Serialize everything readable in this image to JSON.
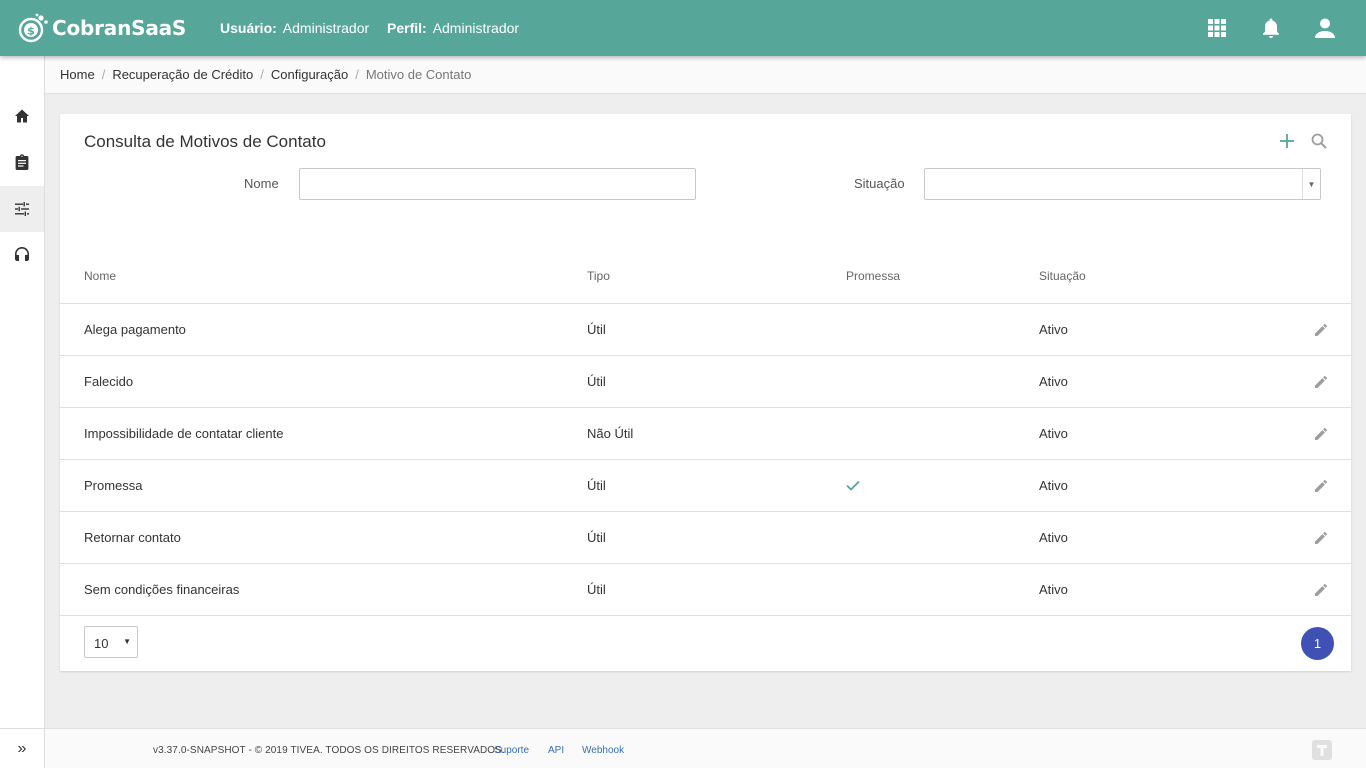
{
  "header": {
    "brand": "CobranSaaS",
    "user_label": "Usuário:",
    "user_value": "Administrador",
    "profile_label": "Perfil:",
    "profile_value": "Administrador",
    "icons": [
      "apps-grid-icon",
      "bell-icon",
      "account-icon"
    ],
    "color": "#56a69a"
  },
  "sidebar": {
    "items": [
      {
        "icon": "home-icon"
      },
      {
        "icon": "clipboard-icon"
      },
      {
        "icon": "sliders-icon",
        "active": true
      },
      {
        "icon": "headset-icon"
      }
    ],
    "expand": "»"
  },
  "breadcrumb": {
    "items": [
      "Home",
      "Recuperação de Crédito",
      "Configuração"
    ],
    "current": "Motivo de Contato",
    "separator": "/"
  },
  "card": {
    "title": "Consulta de Motivos de Contato",
    "filters": {
      "nome_label": "Nome",
      "nome_value": "",
      "situacao_label": "Situação",
      "situacao_value": ""
    }
  },
  "table": {
    "columns": [
      "Nome",
      "Tipo",
      "Promessa",
      "Situação"
    ],
    "rows": [
      {
        "nome": "Alega pagamento",
        "tipo": "Útil",
        "promessa": false,
        "situacao": "Ativo"
      },
      {
        "nome": "Falecido",
        "tipo": "Útil",
        "promessa": false,
        "situacao": "Ativo"
      },
      {
        "nome": "Impossibilidade de contatar cliente",
        "tipo": "Não Útil",
        "promessa": false,
        "situacao": "Ativo"
      },
      {
        "nome": "Promessa",
        "tipo": "Útil",
        "promessa": true,
        "situacao": "Ativo"
      },
      {
        "nome": "Retornar contato",
        "tipo": "Útil",
        "promessa": false,
        "situacao": "Ativo"
      },
      {
        "nome": "Sem condições financeiras",
        "tipo": "Útil",
        "promessa": false,
        "situacao": "Ativo"
      }
    ]
  },
  "pagination": {
    "page_size": "10",
    "current_page": "1",
    "accent": "#3f51b5"
  },
  "footer": {
    "copyright": "v3.37.0-SNAPSHOT - © 2019 TIVEA. TODOS OS DIREITOS RESERVADOS.",
    "links": [
      "Suporte",
      "API",
      "Webhook"
    ]
  }
}
